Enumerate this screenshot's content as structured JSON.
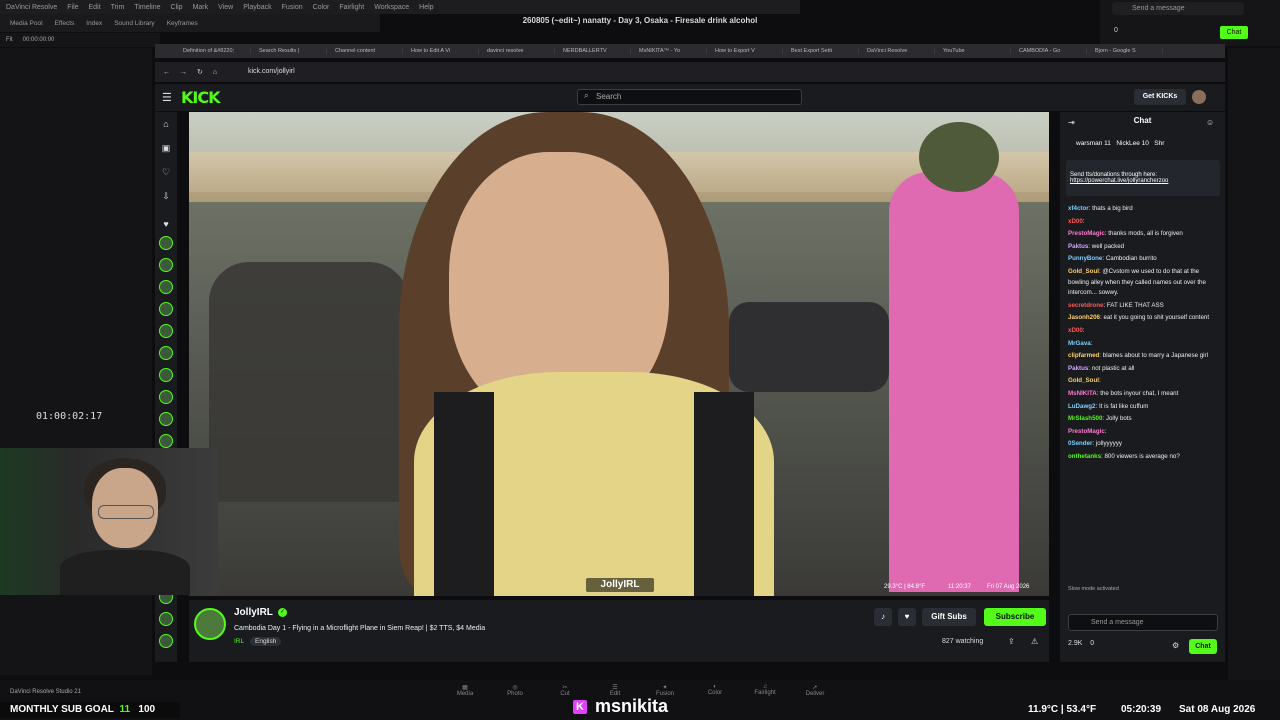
{
  "resolve": {
    "menu": [
      "DaVinci Resolve",
      "File",
      "Edit",
      "Trim",
      "Timeline",
      "Clip",
      "Mark",
      "View",
      "Playback",
      "Fusion",
      "Color",
      "Fairlight",
      "Workspace",
      "Help"
    ],
    "title": "260805 (~edit~) nanatty - Day 3, Osaka - Firesale drink alcohol",
    "tools": [
      "Media Pool",
      "Effects",
      "Index",
      "Sound Library",
      "Keyframes"
    ],
    "sub": [
      "Fit",
      "00:00:00:00"
    ],
    "timecode": "01:00:02:17",
    "studio_label": "DaVinci Resolve Studio 21",
    "pages": [
      "Media",
      "Photo",
      "Cut",
      "Edit",
      "Fusion",
      "Color",
      "Fairlight",
      "Deliver"
    ]
  },
  "overlay_chat": {
    "send_placeholder": "Send a message",
    "count": "0",
    "chat_button": "Chat"
  },
  "browser": {
    "tabs": [
      "Definition of &#8220;",
      "Search Results |",
      "Channel content",
      "How to Edit A Vi",
      "davinci resolve",
      "NERDBALLERTV",
      "MsNIKITA™ - Yo",
      "How to Export V",
      "Best Export Setti",
      "DaVinci Resolve",
      "YouTube",
      "CAMBODIA - Go",
      "Bjorn - Google S"
    ],
    "url": "kick.com/jollyirl"
  },
  "kick": {
    "logo": "KICK",
    "search_placeholder": "Search",
    "get_kicks": "Get KICKs",
    "streamer": "JollyIRL",
    "stream_title": "Cambodia Day 1 - Flying in a Microflight Plane in Siem Reap! | $2 TTS, $4 Media",
    "category": "IRL",
    "language": "English",
    "gift_subs": "Gift Subs",
    "subscribe": "Subscribe",
    "watching": "827 watching",
    "video_tag": "JollyIRL",
    "video_weather": "29.3°C | 84.8°F",
    "video_time": "11:20:37",
    "video_date": "Fri 07 Aug 2026"
  },
  "chat": {
    "title": "Chat",
    "gifters": [
      "warsman 11",
      "NickLee 10",
      "Shr"
    ],
    "pinned_lines": [
      "Send tts/donations through here:",
      "https://powerchat.live/jollyrancherzoo"
    ],
    "messages": [
      {
        "user": "xf4ctor",
        "text": "thats a big bird",
        "color": "#7fd0ff"
      },
      {
        "user": "xD00",
        "text": "",
        "color": "#ff5a5a"
      },
      {
        "user": "PrestoMagic",
        "text": "thanks mods, all is forgiven",
        "color": "#ff7bd0"
      },
      {
        "user": "Paktus",
        "text": "well packed",
        "color": "#d9a6ff"
      },
      {
        "user": "PunnyBone",
        "text": "Cambodian burrito",
        "color": "#7fd0ff"
      },
      {
        "user": "Gold_Soul",
        "text": "@Cvstom we used to do that at the bowling alley when they called names out over the intercom... sowwy.",
        "color": "#ffd166"
      },
      {
        "user": "secretdrone",
        "text": "FAT LIKE THAT ASS",
        "color": "#ff5a5a"
      },
      {
        "user": "Jasonh206",
        "text": "eat it you going to shit yourself content",
        "color": "#ffd166"
      },
      {
        "user": "xD00",
        "text": "",
        "color": "#ff5a5a"
      },
      {
        "user": "MrGava",
        "text": "",
        "color": "#7fd0ff"
      },
      {
        "user": "clipfarmed",
        "text": "blames about to marry a Japanese girl",
        "color": "#ffd166"
      },
      {
        "user": "Paktus",
        "text": "not plastic at all",
        "color": "#d9a6ff"
      },
      {
        "user": "Gold_Soul",
        "text": "",
        "color": "#ffd166"
      },
      {
        "user": "MsNIKITA",
        "text": "the bots inyour chat, I meant",
        "color": "#ff7bd0"
      },
      {
        "user": "LuDawg2",
        "text": "It is fat like cuffum",
        "color": "#7fd0ff"
      },
      {
        "user": "MrSlash500",
        "text": "Jolly bots",
        "color": "#53fc18"
      },
      {
        "user": "PrestoMagic",
        "text": "",
        "color": "#ff7bd0"
      },
      {
        "user": "0Sender",
        "text": "jollyyyyyy",
        "color": "#7fd0ff"
      },
      {
        "user": "onthetanks",
        "text": "800 viewers is average no?",
        "color": "#53fc18"
      }
    ],
    "slow_mode": "Slow mode activated",
    "input_placeholder": "Send a message",
    "kicks_count": "2.9K",
    "points": "0",
    "send_label": "Chat"
  },
  "stream_overlay": {
    "sub_goal": "MONTHLY SUB GOAL",
    "sub_goal_current": "11",
    "sub_goal_target": "100",
    "name": "msnikita",
    "weather": "11.9°C | 53.4°F",
    "clock": "05:20:39",
    "date": "Sat 08 Aug 2026"
  },
  "colors": {
    "kick_green": "#53fc18",
    "panel_bg": "#191b1f",
    "accent_pink": "#e040fb"
  }
}
